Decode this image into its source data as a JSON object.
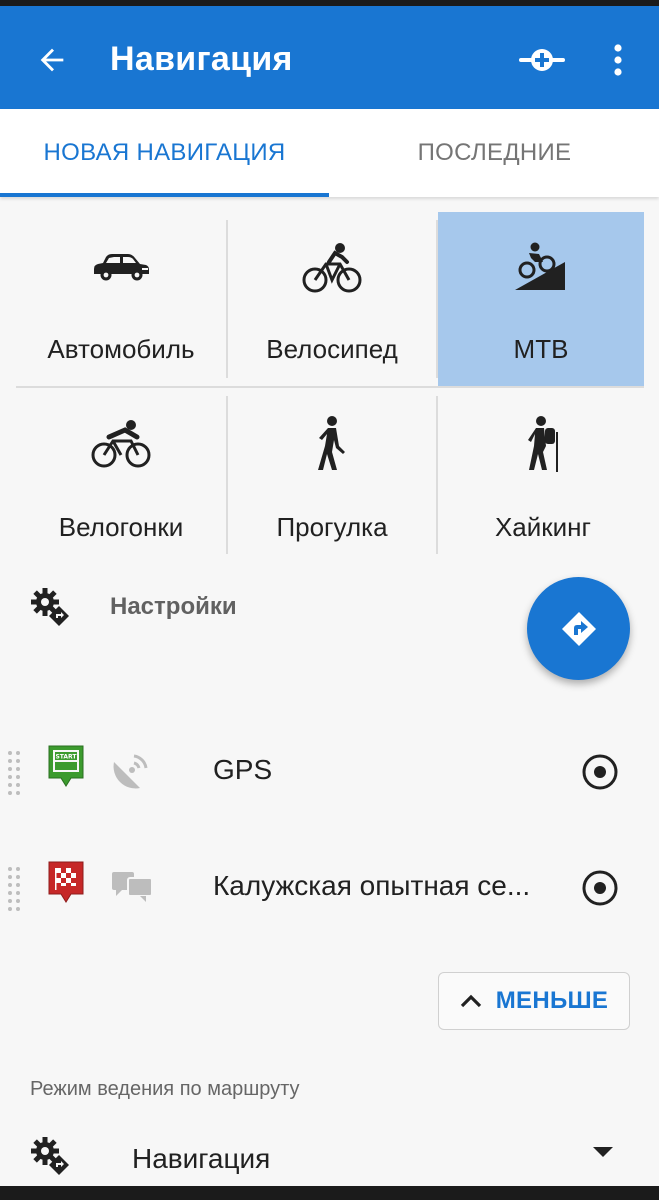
{
  "appbar": {
    "title": "Навигация",
    "back_icon": "arrow-left-icon",
    "waypoint_icon": "add-waypoint-icon",
    "more_icon": "more-vert-icon",
    "color": "#1976d2"
  },
  "tabs": [
    {
      "label": "НОВАЯ НАВИГАЦИЯ",
      "active": true
    },
    {
      "label": "ПОСЛЕДНИЕ",
      "active": false
    }
  ],
  "route_types": [
    {
      "label": "Автомобиль",
      "icon": "car-icon",
      "selected": false
    },
    {
      "label": "Велосипед",
      "icon": "bicycle-icon",
      "selected": false
    },
    {
      "label": "МТВ",
      "icon": "mtb-icon",
      "selected": true
    },
    {
      "label": "Велогонки",
      "icon": "road-bike-icon",
      "selected": false
    },
    {
      "label": "Прогулка",
      "icon": "walking-icon",
      "selected": false
    },
    {
      "label": "Хайкинг",
      "icon": "hiking-icon",
      "selected": false
    }
  ],
  "settings": {
    "label": "Настройки",
    "icon": "settings-route-icon"
  },
  "fab": {
    "icon": "route-direction-icon"
  },
  "waypoints": [
    {
      "flag": "start-flag-icon",
      "flag_text": "START",
      "source_icon": "gps-satellite-icon",
      "name": "GPS",
      "radio_icon": "radio-selected-icon"
    },
    {
      "flag": "finish-flag-icon",
      "flag_text": "",
      "source_icon": "poi-search-icon",
      "name": "Калужская опытная се...",
      "radio_icon": "radio-selected-icon"
    }
  ],
  "less_button": {
    "label": "МЕНЬШЕ",
    "icon": "chevron-up-icon"
  },
  "guidance_mode": {
    "section_label": "Режим ведения по маршруту",
    "value": "Навигация",
    "icon": "settings-route-icon",
    "dropdown_icon": "dropdown-arrow-icon"
  },
  "colors": {
    "primary": "#1976d2",
    "selected_tile": "#a6c8ec",
    "start_flag": "#3c9b2e",
    "finish_flag": "#c62828"
  }
}
